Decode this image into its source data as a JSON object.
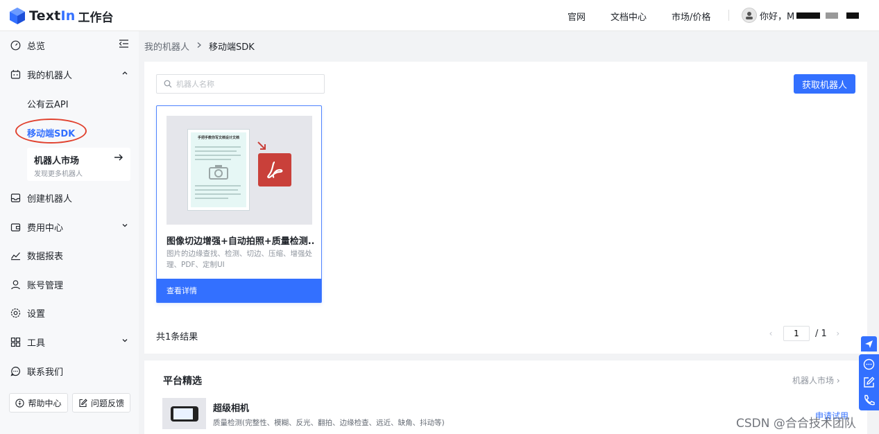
{
  "header": {
    "brand_text_a": "Text",
    "brand_text_b": "In",
    "brand_sub": "工作台",
    "nav": [
      {
        "label": "官网"
      },
      {
        "label": "文档中心"
      },
      {
        "label": "市场/价格"
      }
    ],
    "user_greeting": "你好，M"
  },
  "sidebar": {
    "items": [
      {
        "label": "总览"
      },
      {
        "label": "我的机器人"
      },
      {
        "label": "创建机器人"
      },
      {
        "label": "费用中心"
      },
      {
        "label": "数据报表"
      },
      {
        "label": "账号管理"
      },
      {
        "label": "设置"
      },
      {
        "label": "工具"
      },
      {
        "label": "联系我们"
      }
    ],
    "subitems": [
      {
        "label": "公有云API"
      },
      {
        "label": "移动端SDK"
      }
    ],
    "market": {
      "title": "机器人市场",
      "subtitle": "发现更多机器人"
    },
    "footer": {
      "help_label": "帮助中心",
      "feedback_label": "问题反馈"
    }
  },
  "breadcrumb": {
    "parent": "我的机器人",
    "current": "移动端SDK"
  },
  "main": {
    "search_placeholder": "机器人名称",
    "get_robot_label": "获取机器人",
    "card": {
      "doc_title": "手把手教你写文档设计文档",
      "title": "图像切边增强+自动拍照+质量检测...",
      "description": "图片的边缘查找、检测、切边、压缩、增强处理、PDF、定制UI",
      "action_label": "查看详情"
    },
    "result_count": "共1条结果",
    "pagination": {
      "current_page": "1",
      "total": "/ 1"
    }
  },
  "featured": {
    "title": "平台精选",
    "market_link": "机器人市场",
    "item": {
      "name": "超级相机",
      "description": "质量检测(完整性、模糊、反光、翻拍、边缘检查、远近、缺角、抖动等)",
      "action": "申请试用"
    }
  },
  "watermark": "CSDN @合合技术团队",
  "colors": {
    "primary": "#3370ff",
    "highlight_ring": "#e1422f",
    "pdf_red": "#c9403a"
  }
}
